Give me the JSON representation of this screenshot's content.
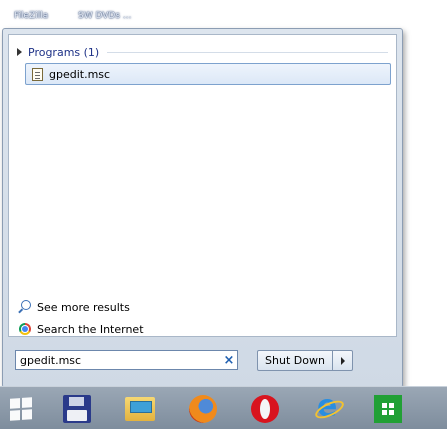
{
  "desktop": {
    "shortcuts": [
      "FileZilla",
      "SW DVDs ..."
    ]
  },
  "start_menu": {
    "group_title": "Programs (1)",
    "result_item": "gpedit.msc",
    "see_more_results": "See more results",
    "search_internet": "Search the Internet",
    "search_value": "gpedit.msc",
    "shutdown_label": "Shut Down"
  },
  "taskbar": {
    "items": [
      "windows-start",
      "save-floppy",
      "file-explorer",
      "firefox",
      "opera",
      "internet-explorer",
      "windows-store"
    ]
  }
}
